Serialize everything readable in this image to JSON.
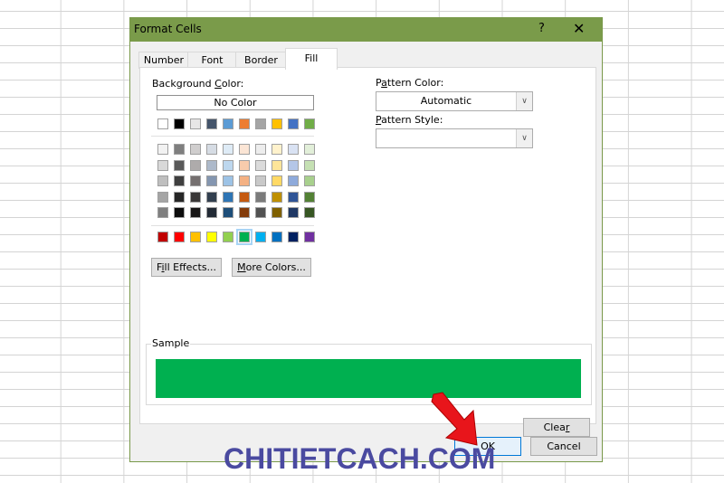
{
  "dialog": {
    "title": "Format Cells",
    "help_label": "?",
    "close_label": "✕",
    "tabs": [
      {
        "label": "Number"
      },
      {
        "label": "Font"
      },
      {
        "label": "Border"
      },
      {
        "label": "Fill",
        "active": true
      }
    ],
    "fill": {
      "background_color_label_pre": "Background ",
      "background_color_label_key": "C",
      "background_color_label_post": "olor:",
      "no_color_label": "No Color",
      "theme_row": [
        "#ffffff",
        "#000000",
        "#e7e6e6",
        "#44546a",
        "#5b9bd5",
        "#ed7d31",
        "#a5a5a5",
        "#ffc000",
        "#4472c4",
        "#70ad47"
      ],
      "shade_rows": [
        [
          "#f2f2f2",
          "#7f7f7f",
          "#d0cece",
          "#d6dce4",
          "#deebf6",
          "#fbe5d5",
          "#ededed",
          "#fff2cc",
          "#d9e2f3",
          "#e2efd9"
        ],
        [
          "#d8d8d8",
          "#595959",
          "#aeabab",
          "#adb9ca",
          "#bdd7ee",
          "#f7cbac",
          "#dbdbdb",
          "#fee599",
          "#b4c6e7",
          "#c5e0b3"
        ],
        [
          "#bfbfbf",
          "#3f3f3f",
          "#757070",
          "#8496b0",
          "#9dc3e6",
          "#f4b183",
          "#c9c9c9",
          "#ffd965",
          "#8eaadb",
          "#a8d08d"
        ],
        [
          "#a5a5a5",
          "#262626",
          "#3a3838",
          "#323f4f",
          "#2e75b5",
          "#c55a11",
          "#7b7b7b",
          "#bf9000",
          "#2f5496",
          "#538135"
        ],
        [
          "#7f7f7f",
          "#0c0c0c",
          "#171616",
          "#222a35",
          "#1e4e79",
          "#843c0b",
          "#525252",
          "#7f6000",
          "#1f3864",
          "#375623"
        ]
      ],
      "standard_row": [
        "#c00000",
        "#ff0000",
        "#ffc000",
        "#ffff00",
        "#92d050",
        "#00b050",
        "#00b0f0",
        "#0070c0",
        "#002060",
        "#7030a0"
      ],
      "selected_standard_index": 5,
      "fill_effects_pre": "F",
      "fill_effects_key": "i",
      "fill_effects_post": "ll Effects...",
      "more_colors_key": "M",
      "more_colors_post": "ore Colors...",
      "pattern_color_pre": "P",
      "pattern_color_key": "a",
      "pattern_color_post": "ttern Color:",
      "pattern_color_value": "Automatic",
      "pattern_style_key": "P",
      "pattern_style_post": "attern Style:",
      "pattern_style_value": "",
      "sample_label": "Sample",
      "sample_color": "#00b050",
      "clear_pre": "Clea",
      "clear_key": "r"
    },
    "ok_label": "OK",
    "cancel_label": "Cancel"
  },
  "watermark": "CHITIETCACH.COM",
  "colors": {
    "title_bar": "#7a9b4a",
    "arrow": "#e8151b"
  }
}
